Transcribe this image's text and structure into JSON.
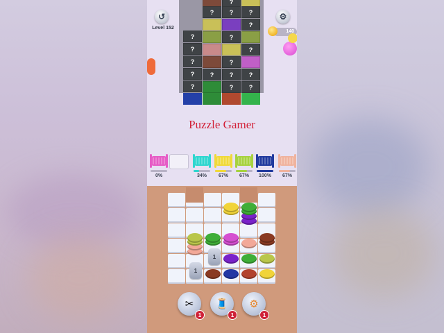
{
  "header": {
    "level_label": "Level 152",
    "coins": "140"
  },
  "board_stack": {
    "hidden_mark": "?"
  },
  "title": "Puzzle Gamer",
  "spools": [
    {
      "color": "#e65cc6",
      "percent": "0%"
    },
    {
      "color": "#2fd6cf",
      "percent": "34%"
    },
    {
      "color": "#f0d93a",
      "percent": "67%"
    },
    {
      "color": "#a7d23f",
      "percent": "67%"
    },
    {
      "color": "#213a9e",
      "percent": "100%"
    },
    {
      "color": "#f0b39e",
      "percent": "67%"
    }
  ],
  "locked_count": "1",
  "tools": [
    {
      "icon": "scissors-icon",
      "badge": "1"
    },
    {
      "icon": "spool-magnet-icon",
      "badge": "1"
    },
    {
      "icon": "wrench-icon",
      "badge": "1"
    }
  ],
  "colors": {
    "yellow": "#f1d43a",
    "green": "#3fae38",
    "purple": "#7a22c9",
    "magenta": "#d54fd0",
    "pink": "#f2a898",
    "brown": "#8a3a22",
    "olive": "#b9c64a",
    "blue": "#2337a4",
    "red": "#b2432e"
  }
}
